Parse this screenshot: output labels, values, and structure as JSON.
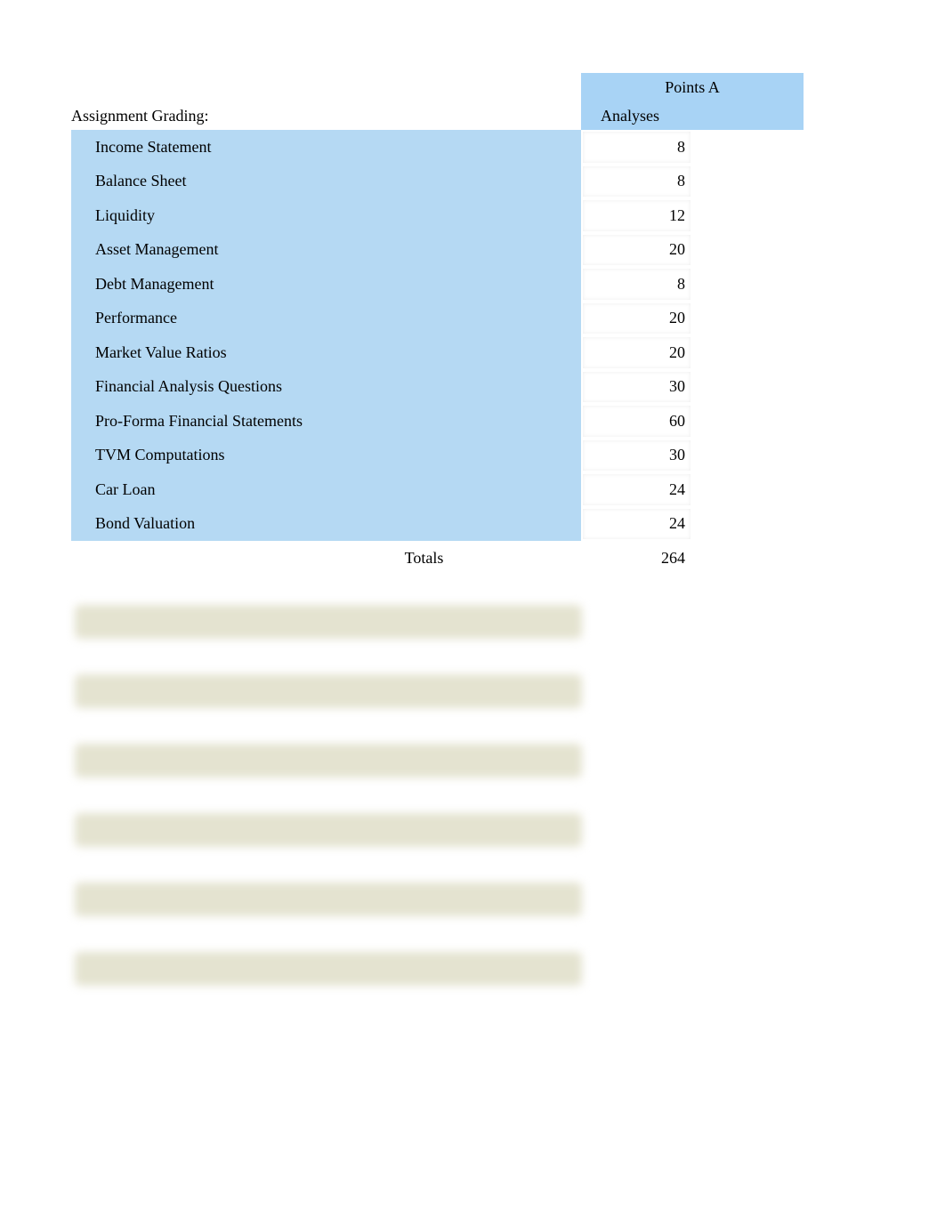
{
  "header": {
    "points_a": "Points A",
    "analyses": "Analyses",
    "assignment_grading": "Assignment Grading:"
  },
  "rows": [
    {
      "label": "Income Statement",
      "value": "8"
    },
    {
      "label": "Balance Sheet",
      "value": "8"
    },
    {
      "label": "Liquidity",
      "value": "12"
    },
    {
      "label": "Asset Management",
      "value": "20"
    },
    {
      "label": "Debt Management",
      "value": "8"
    },
    {
      "label": "Performance",
      "value": "20"
    },
    {
      "label": "Market Value Ratios",
      "value": "20"
    },
    {
      "label": "Financial Analysis Questions",
      "value": "30"
    },
    {
      "label": "Pro-Forma Financial Statements",
      "value": "60"
    },
    {
      "label": "TVM Computations",
      "value": "30"
    },
    {
      "label": "Car Loan",
      "value": "24"
    },
    {
      "label": "Bond Valuation",
      "value": "24"
    }
  ],
  "totals": {
    "label": "Totals",
    "value": "264"
  }
}
